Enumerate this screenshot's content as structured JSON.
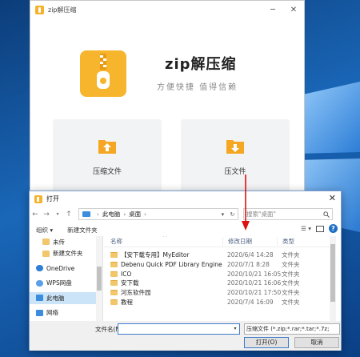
{
  "app": {
    "title": "zip解压缩",
    "name": "zip解压缩",
    "slogan": "方便快捷 值得信赖",
    "compress_label": "压缩文件",
    "extract_label": "压文件",
    "accent_color": "#f7b52d"
  },
  "dialog": {
    "title": "打开",
    "address": {
      "root": "此电脑",
      "current": "桌面"
    },
    "search_placeholder": "搜索\"桌面\"",
    "toolbar": {
      "organize": "组织 ▾",
      "new_folder": "新建文件夹"
    },
    "nav_items": [
      {
        "label": "未传",
        "icon": "folder-icon"
      },
      {
        "label": "新建文件夹",
        "icon": "folder-icon"
      },
      {
        "label": "OneDrive",
        "icon": "cloud-icon"
      },
      {
        "label": "WPS网盘",
        "icon": "cloud-icon"
      },
      {
        "label": "此电脑",
        "icon": "computer-icon",
        "selected": true
      },
      {
        "label": "网络",
        "icon": "network-icon"
      }
    ],
    "columns": {
      "name": "名称",
      "date": "修改日期",
      "type": "类型"
    },
    "files": [
      {
        "name": "【安下载专用】MyEditor",
        "date": "2020/6/4 14:28",
        "type": "文件夹"
      },
      {
        "name": "Debenu Quick PDF Library Engine",
        "date": "2020/7/1 8:28",
        "type": "文件夹"
      },
      {
        "name": "ICO",
        "date": "2020/10/21 16:05",
        "type": "文件夹"
      },
      {
        "name": "安下载",
        "date": "2020/10/21 16:06",
        "type": "文件夹"
      },
      {
        "name": "河东软件园",
        "date": "2020/10/21 17:50",
        "type": "文件夹"
      },
      {
        "name": "教程",
        "date": "2020/7/4 16:09",
        "type": "文件夹"
      }
    ],
    "filename_label": "文件名(N):",
    "filename_value": "",
    "file_type": "压缩文件 (*.zip;*.rar;*.tar;*.7z;",
    "open_label": "打开(O)",
    "cancel_label": "取消"
  }
}
